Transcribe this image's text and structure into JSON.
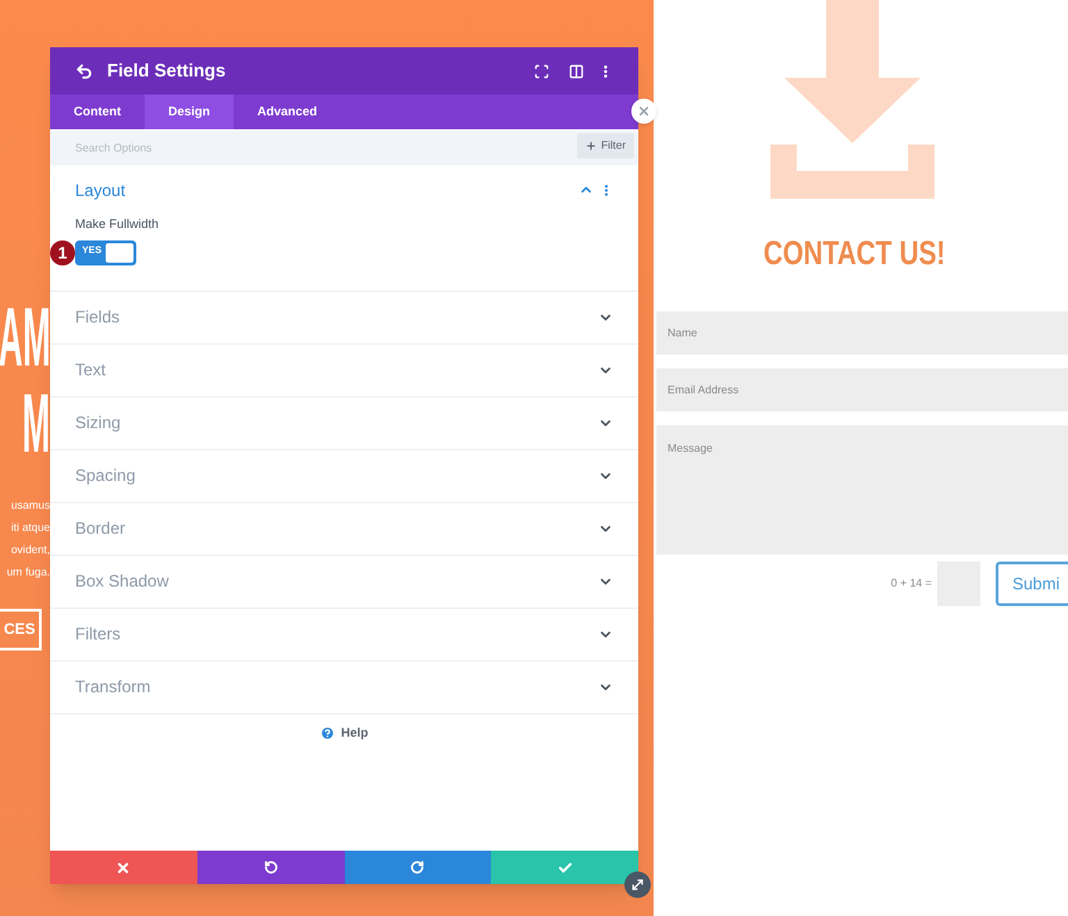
{
  "backdrop": {
    "headline_lines": [
      "AM",
      "M"
    ],
    "body_lines": [
      "usamus",
      "iti atque",
      "ovident,",
      "um fuga."
    ],
    "button": "CES"
  },
  "modal": {
    "title": "Field Settings",
    "tabs": [
      {
        "label": "Content",
        "selected": false
      },
      {
        "label": "Design",
        "selected": true
      },
      {
        "label": "Advanced",
        "selected": false
      }
    ],
    "search": {
      "placeholder": "Search Options"
    },
    "filter_button": "Filter",
    "sections": [
      {
        "title": "Layout",
        "expanded": true,
        "settings": [
          {
            "label": "Make Fullwidth",
            "toggle": {
              "on": true,
              "label": "YES"
            },
            "marker": "1"
          }
        ]
      },
      {
        "title": "Fields",
        "expanded": false
      },
      {
        "title": "Text",
        "expanded": false
      },
      {
        "title": "Sizing",
        "expanded": false
      },
      {
        "title": "Spacing",
        "expanded": false
      },
      {
        "title": "Border",
        "expanded": false
      },
      {
        "title": "Box Shadow",
        "expanded": false
      },
      {
        "title": "Filters",
        "expanded": false
      },
      {
        "title": "Transform",
        "expanded": false
      }
    ],
    "help": "Help"
  },
  "contact": {
    "title": "CONTACT US!",
    "fields": [
      {
        "kind": "line",
        "placeholder": "Name"
      },
      {
        "kind": "line",
        "placeholder": "Email Address"
      },
      {
        "kind": "area",
        "placeholder": "Message"
      }
    ],
    "captcha": "0 + 14 =",
    "submit": "Submi"
  }
}
